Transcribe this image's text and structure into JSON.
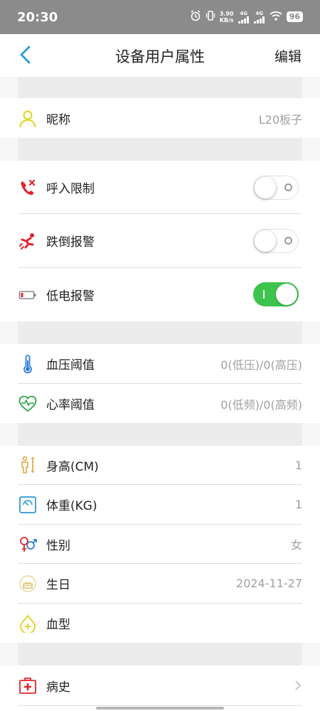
{
  "status_bar": {
    "time": "20:30",
    "speed_top": "3.90",
    "speed_bottom": "KB/s",
    "net1": "4G",
    "net2": "4G",
    "battery": "96"
  },
  "header": {
    "title": "设备用户属性",
    "edit_label": "编辑"
  },
  "nickname": {
    "label": "昵称",
    "value": "L20板子"
  },
  "alerts": [
    {
      "label": "呼入限制",
      "enabled": false
    },
    {
      "label": "跌倒报警",
      "enabled": false
    },
    {
      "label": "低电报警",
      "enabled": true
    }
  ],
  "thresholds": [
    {
      "label": "血压阈值",
      "value": "0(低压)/0(高压)"
    },
    {
      "label": "心率阈值",
      "value": "0(低频)/0(高频)"
    }
  ],
  "profile": [
    {
      "label": "身高(CM)",
      "value": "1"
    },
    {
      "label": "体重(KG)",
      "value": "1"
    },
    {
      "label": "性别",
      "value": "女"
    },
    {
      "label": "生日",
      "value": "2024-11-27"
    },
    {
      "label": "血型",
      "value": ""
    }
  ],
  "history": {
    "label": "病史"
  },
  "colors": {
    "toggle_on": "#3cc44c",
    "accent_blue": "#2b9ad8"
  }
}
